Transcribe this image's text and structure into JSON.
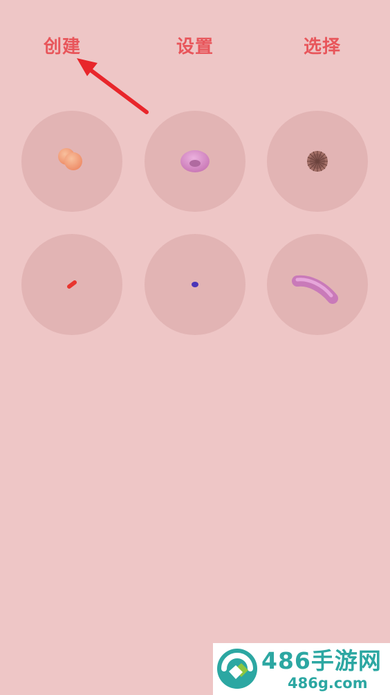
{
  "top_menu": {
    "create": "创建",
    "settings": "设置",
    "select": "选择"
  },
  "annotation": {
    "arrow_color": "#e8262b",
    "target": "menu-create"
  },
  "grid": {
    "items": [
      {
        "shape": "double-sphere-icon",
        "color": "#f09a7a"
      },
      {
        "shape": "torus-icon",
        "color": "#d985c0"
      },
      {
        "shape": "spiky-ball-icon",
        "color": "#9e6a63"
      },
      {
        "shape": "small-capsule-icon",
        "color": "#e8352f"
      },
      {
        "shape": "small-blob-icon",
        "color": "#4a35b8"
      },
      {
        "shape": "curved-tube-icon",
        "color": "#d48ac6"
      }
    ]
  },
  "watermark": {
    "title": "486手游网",
    "url": "486g.com",
    "color": "#2ca7a2",
    "accent": "#8dc63f"
  }
}
